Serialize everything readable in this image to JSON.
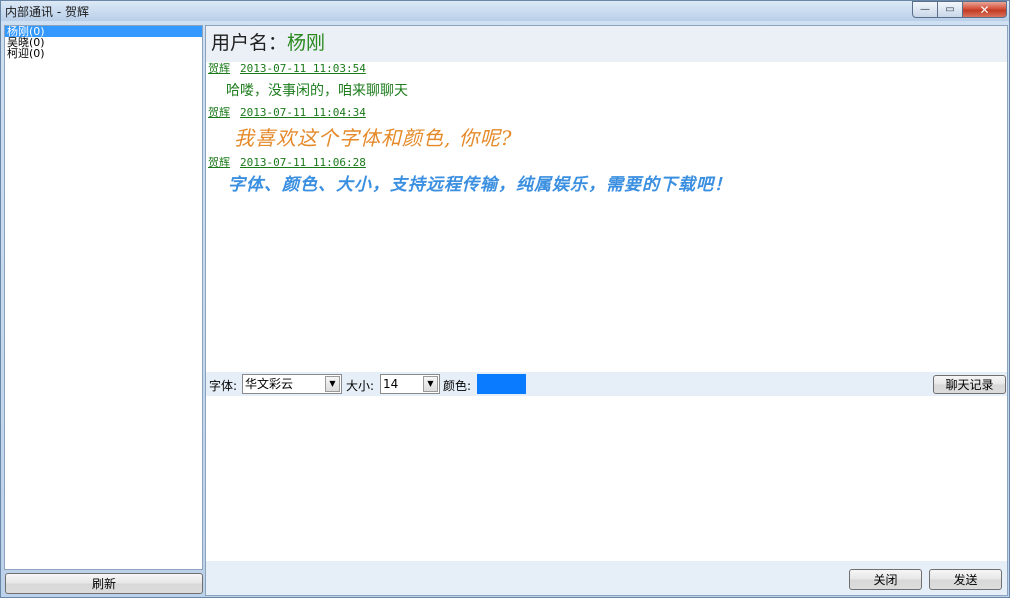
{
  "window": {
    "title": "内部通讯 - 贺辉",
    "controls": {
      "minimize": "—",
      "maximize": "▭",
      "close": "✕"
    }
  },
  "contacts": [
    {
      "label": "杨刚(0)",
      "selected": true
    },
    {
      "label": "吴晓(0)",
      "selected": false
    },
    {
      "label": "柯迎(0)",
      "selected": false
    }
  ],
  "refresh_label": "刷新",
  "header": {
    "prefix": "用户名：",
    "username": "杨刚"
  },
  "messages": [
    {
      "sender": "贺辉",
      "time": "2013-07-11 11:03:54",
      "text": "哈喽，没事闲的，咱来聊聊天",
      "color": "#1e7d1e"
    },
    {
      "sender": "贺辉",
      "time": "2013-07-11 11:04:34",
      "text": "我喜欢这个字体和颜色, 你呢?",
      "color": "#e58a2a"
    },
    {
      "sender": "贺辉",
      "time": "2013-07-11 11:06:28",
      "text": "字体、颜色、大小，支持远程传输，纯属娱乐，需要的下载吧！",
      "color": "#3a8fe0"
    }
  ],
  "toolbar": {
    "font_label": "字体:",
    "font_value": "华文彩云",
    "size_label": "大小:",
    "size_value": "14",
    "color_label": "颜色:",
    "color_value": "#0a7bff",
    "history_label": "聊天记录"
  },
  "bottom": {
    "close_label": "关闭",
    "send_label": "发送"
  }
}
